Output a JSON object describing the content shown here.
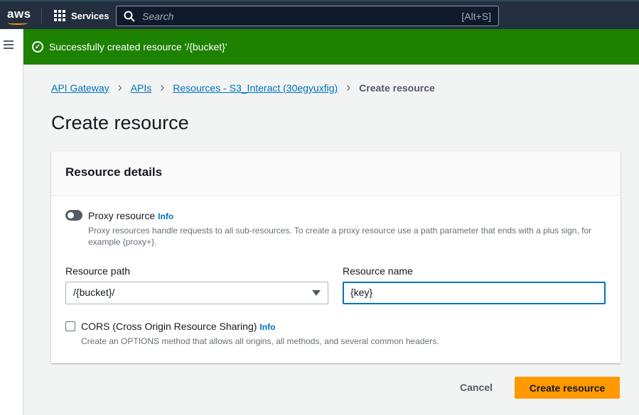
{
  "nav": {
    "logo": "aws",
    "services": "Services",
    "search_placeholder": "Search",
    "search_shortcut": "[Alt+S]"
  },
  "banner": {
    "message": "Successfully created resource '/{bucket}'"
  },
  "breadcrumb": [
    "API Gateway",
    "APIs",
    "Resources - S3_Interact (30egyuxfig)",
    "Create resource"
  ],
  "title": "Create resource",
  "card": {
    "header": "Resource details",
    "proxy": {
      "label": "Proxy resource",
      "info": "Info",
      "enabled": false,
      "description": "Proxy resources handle requests to all sub-resources. To create a proxy resource use a path parameter that ends with a plus sign, for example {proxy+}."
    },
    "resource_path": {
      "label": "Resource path",
      "value": "/{bucket}/"
    },
    "resource_name": {
      "label": "Resource name",
      "value": "{key}"
    },
    "cors": {
      "label": "CORS (Cross Origin Resource Sharing)",
      "info": "Info",
      "checked": false,
      "description": "Create an OPTIONS method that allows all origins, all methods, and several common headers."
    }
  },
  "actions": {
    "cancel": "Cancel",
    "create": "Create resource"
  },
  "colors": {
    "accent": "#ff9900",
    "success": "#1d8102",
    "link": "#0073bb",
    "nav": "#232f3e"
  }
}
